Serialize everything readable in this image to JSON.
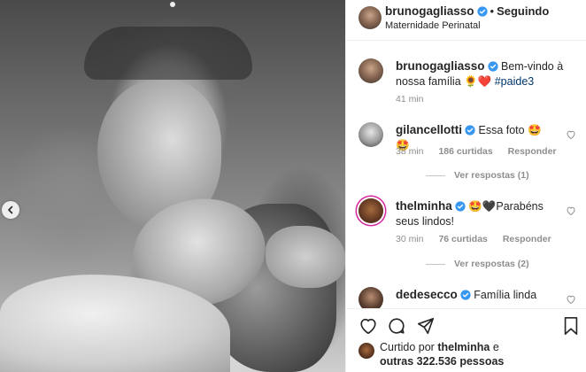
{
  "post": {
    "author": "brunogagliasso",
    "follow_status": "Seguindo",
    "location": "Maternidade Perinatal",
    "caption": "Bem-vindo à nossa família 🌻❤️",
    "hashtag": "#paide3",
    "caption_time": "41 min"
  },
  "comments": [
    {
      "user": "gilancellotti",
      "text": "Essa foto 🤩🤩",
      "time": "38 min",
      "likes": "186 curtidas",
      "reply": "Responder",
      "more": "Ver respostas (1)"
    },
    {
      "user": "thelminha",
      "text": "🤩🖤Parabéns seus lindos!",
      "time": "30 min",
      "likes": "76 curtidas",
      "reply": "Responder",
      "more": "Ver respostas (2)"
    },
    {
      "user": "dedesecco",
      "text": "Família linda"
    }
  ],
  "likes": {
    "prefix": "Curtido por",
    "user": "thelminha",
    "connector": "e",
    "others": "outras 322.536 pessoas"
  },
  "icons": {
    "verified": "verified-badge-icon",
    "heart": "heart-icon",
    "comment": "comment-icon",
    "share": "share-icon",
    "bookmark": "bookmark-icon",
    "prev": "chevron-left-icon"
  },
  "colors": {
    "verified": "#3897f0",
    "link": "#00376b",
    "muted": "#8e8e8e",
    "story_ring": "#d6249f"
  }
}
